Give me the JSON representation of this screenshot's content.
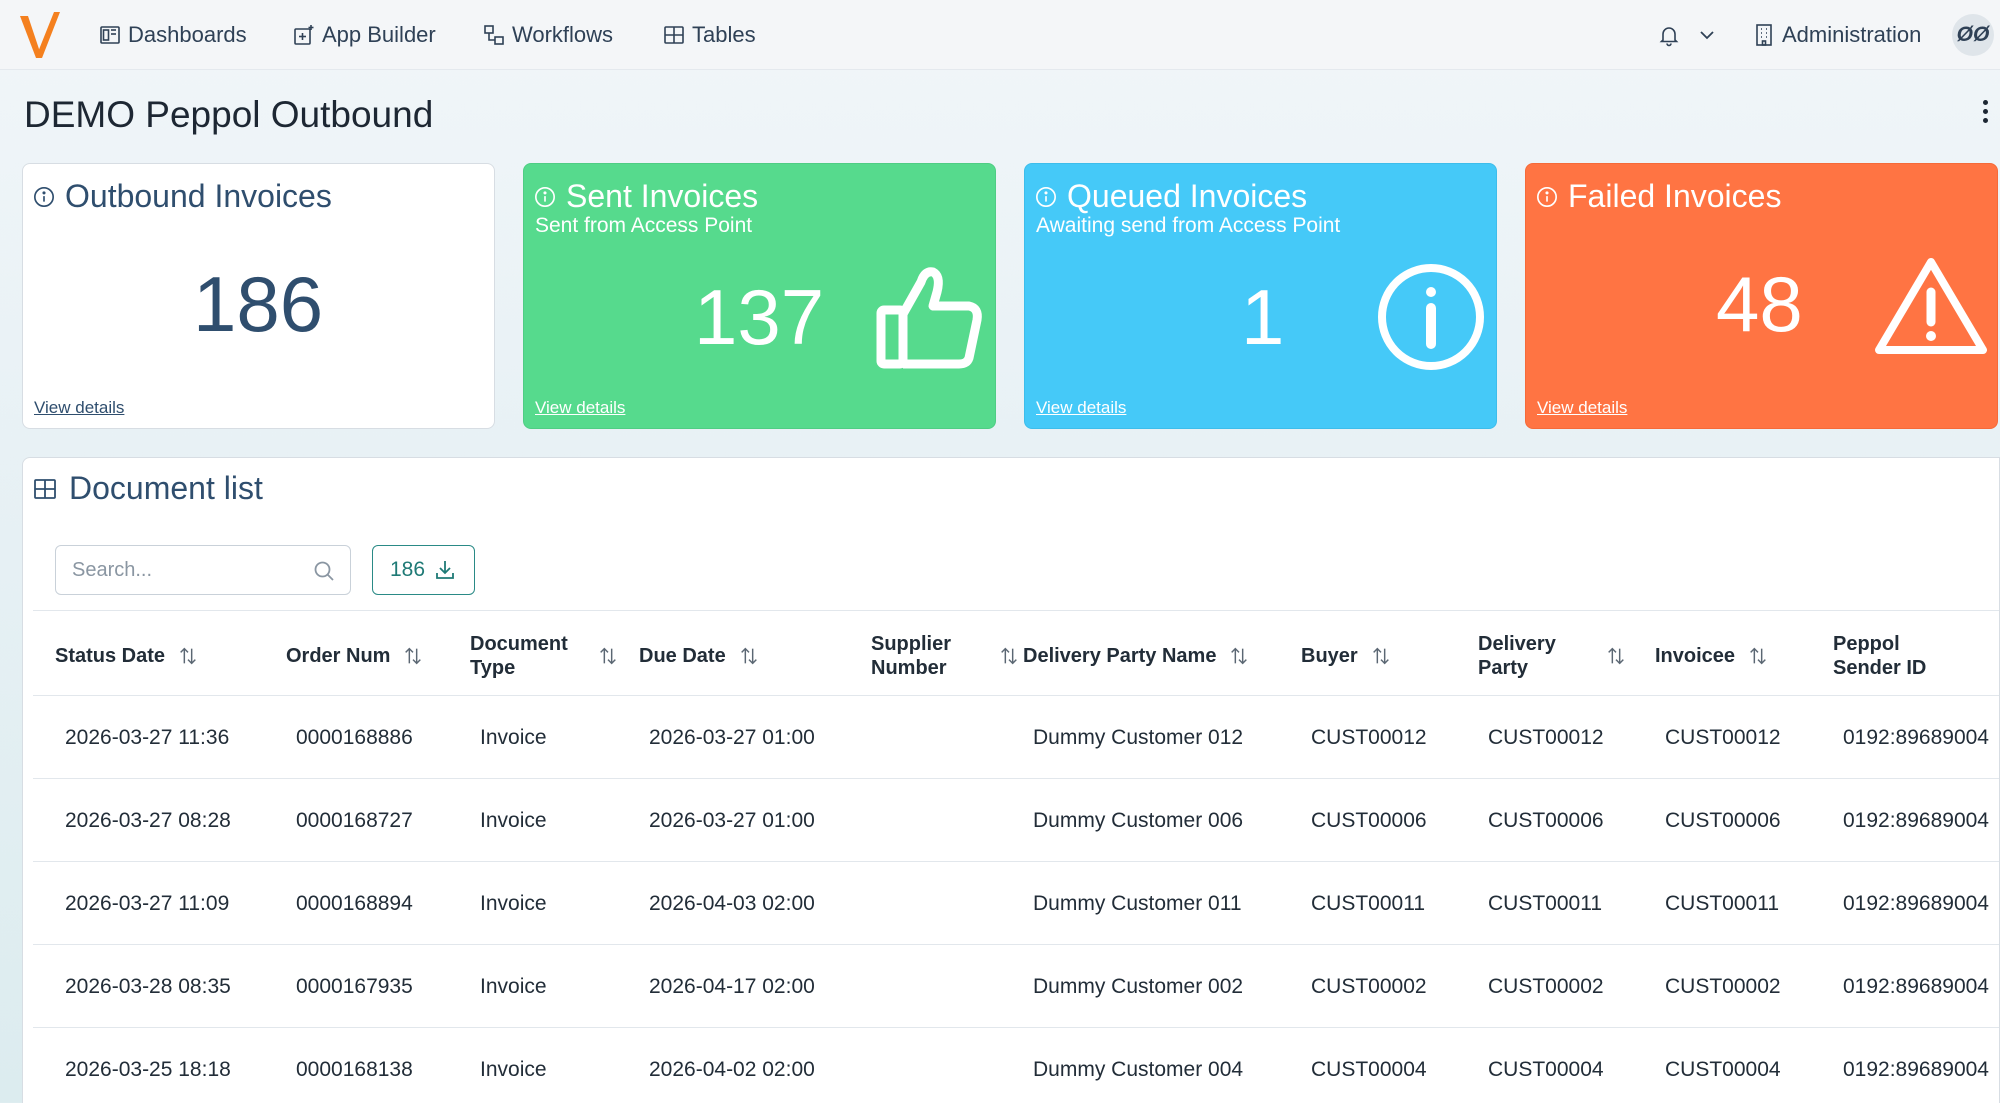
{
  "nav": {
    "items": [
      {
        "label": "Dashboards",
        "icon": "dashboard-icon"
      },
      {
        "label": "App Builder",
        "icon": "app-builder-icon"
      },
      {
        "label": "Workflows",
        "icon": "workflows-icon"
      },
      {
        "label": "Tables",
        "icon": "table-icon"
      }
    ],
    "administration": "Administration",
    "avatar_initials": "ØØ"
  },
  "page": {
    "title": "DEMO Peppol Outbound"
  },
  "cards": [
    {
      "title": "Outbound Invoices",
      "subtitle": "",
      "value": "186",
      "link": "View details",
      "icon": "info-icon",
      "color": "#ffffff"
    },
    {
      "title": "Sent Invoices",
      "subtitle": "Sent from Access Point",
      "value": "137",
      "link": "View details",
      "icon": "thumbs-up-icon",
      "color": "#56da8d"
    },
    {
      "title": "Queued Invoices",
      "subtitle": "Awaiting send from Access Point",
      "value": "1",
      "link": "View details",
      "icon": "info-circle-icon",
      "color": "#45c9f8"
    },
    {
      "title": "Failed Invoices",
      "subtitle": "",
      "value": "48",
      "link": "View details",
      "icon": "warning-icon",
      "color": "#ff7443"
    }
  ],
  "document_list": {
    "title": "Document list",
    "search_placeholder": "Search...",
    "count": "186",
    "columns": [
      "Status Date",
      "Order Num",
      "Document Type",
      "Due Date",
      "Supplier Number",
      "Delivery Party Name",
      "Buyer",
      "Delivery Party",
      "Invoicee",
      "Peppol Sender ID"
    ],
    "rows": [
      [
        "2026-03-27 11:36",
        "0000168886",
        "Invoice",
        "2026-03-27 01:00",
        "",
        "Dummy Customer 012",
        "CUST00012",
        "CUST00012",
        "CUST00012",
        "0192:89689004"
      ],
      [
        "2026-03-27 08:28",
        "0000168727",
        "Invoice",
        "2026-03-27 01:00",
        "",
        "Dummy Customer 006",
        "CUST00006",
        "CUST00006",
        "CUST00006",
        "0192:89689004"
      ],
      [
        "2026-03-27 11:09",
        "0000168894",
        "Invoice",
        "2026-04-03 02:00",
        "",
        "Dummy Customer 011",
        "CUST00011",
        "CUST00011",
        "CUST00011",
        "0192:89689004"
      ],
      [
        "2026-03-28 08:35",
        "0000167935",
        "Invoice",
        "2026-04-17 02:00",
        "",
        "Dummy Customer 002",
        "CUST00002",
        "CUST00002",
        "CUST00002",
        "0192:89689004"
      ],
      [
        "2026-03-25 18:18",
        "0000168138",
        "Invoice",
        "2026-04-02 02:00",
        "",
        "Dummy Customer 004",
        "CUST00004",
        "CUST00004",
        "CUST00004",
        "0192:89689004"
      ]
    ]
  },
  "colors": {
    "accent": "#f4801f",
    "teal": "#2a8a86",
    "title": "#2f4e6e"
  }
}
